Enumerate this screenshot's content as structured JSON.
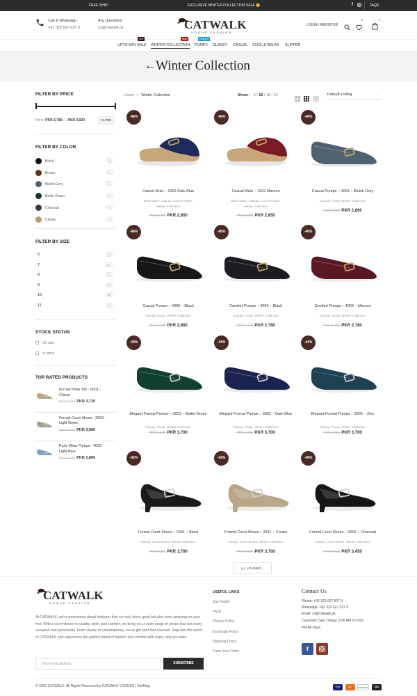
{
  "topbar": {
    "left": "FREE SHIP!",
    "center": "EXCLUSIVE WINTER COLLECTION SALE 🙂",
    "right": "FAQS"
  },
  "header": {
    "call_title": "Call & Whatsapp",
    "call_number": "+92 322 627 627 9",
    "q_title": "Any questions",
    "q_email": "cs@catwalk.pk",
    "logo": "CATWALK",
    "logo_sub": "VOGUE  FASHION",
    "login": "LOGIN / REGISTER",
    "wishlist_count": "0",
    "cart_count": "0"
  },
  "nav": {
    "items": [
      "UPTO 50% SALE",
      "WINTER COLLECTION",
      "PUMPS",
      "GLASSY",
      "CASUAL",
      "COOL & RELAX",
      "SLIPPER"
    ],
    "tags": [
      "HOT",
      "NEW",
      "FASHION"
    ]
  },
  "banner": {
    "title": "Winter Collection",
    "back": "←"
  },
  "breadcrumb": {
    "home": "Home",
    "sep": "/",
    "current": "Winter Collection"
  },
  "toolbar": {
    "show_label": "Show :",
    "show_opts": [
      "9",
      "12",
      "18",
      "24"
    ],
    "sort": "Default sorting"
  },
  "filters": {
    "price": {
      "title": "FILTER BY PRICE",
      "label": "Price:",
      "min": "PKR 2,780",
      "dash": "—",
      "max": "PKR 3,920",
      "button": "FILTER"
    },
    "color": {
      "title": "FILTER BY COLOR",
      "items": [
        {
          "name": "Black",
          "count": "6",
          "hex": "#111111"
        },
        {
          "name": "Brown",
          "count": "1",
          "hex": "#5a3318"
        },
        {
          "name": "Bluish Grey",
          "count": "1",
          "hex": "#4f6270"
        },
        {
          "name": "Bottle Green",
          "count": "1",
          "hex": "#14382c"
        },
        {
          "name": "Charcoal",
          "count": "1",
          "hex": "#3a3a3a"
        },
        {
          "name": "Chicko",
          "count": "3",
          "hex": "#b99a75"
        }
      ]
    },
    "size": {
      "title": "FILTER BY SIZE",
      "items": [
        {
          "name": "6",
          "count": "13"
        },
        {
          "name": "7",
          "count": "27"
        },
        {
          "name": "8",
          "count": "27"
        },
        {
          "name": "9",
          "count": "27"
        },
        {
          "name": "10",
          "count": "28"
        },
        {
          "name": "11",
          "count": "9"
        }
      ]
    },
    "stock": {
      "title": "STOCK STATUS",
      "items": [
        "On sale",
        "In stock"
      ]
    }
  },
  "top_rated": {
    "title": "TOP RATED PRODUCTS",
    "items": [
      {
        "name1": "Formal Peep Toe - 6001 -",
        "name2": "Chicko",
        "old": "PKR 7,440",
        "price": "PKR 3,720"
      },
      {
        "name1": "Formal Court Shoes - 2003 -",
        "name2": "Light Green",
        "old": "PKR 6,550",
        "price": "PKR 3,580"
      },
      {
        "name1": "Party Wear Pumps - 4003 -",
        "name2": "Light Blue",
        "old": "PKR 5,320",
        "price": "PKR 2,860"
      }
    ]
  },
  "products": [
    {
      "badge": "-46%",
      "name": "Casual Mule – 1002 Dark Blue",
      "cat1": "Back Open, Casual, Cool & Relax,",
      "cat2": "Winter Collection",
      "old": "PKR 5,280",
      "price": "PKR 2,850"
    },
    {
      "badge": "-46%",
      "name": "Casual Mule – 1002 Maroon",
      "cat1": "Back Open, Casual, Cool & Relax,",
      "cat2": "Winter Collection",
      "old": "PKR 5,280",
      "price": "PKR 2,850"
    },
    {
      "badge": "-46%",
      "name": "Casual Pumps – 4004 – Bluish Grey",
      "cat1": "Casual, Pump, Winter Collection",
      "cat2": "",
      "old": "PKR 5,300",
      "price": "PKR 2,860"
    },
    {
      "badge": "-46%",
      "name": "Casual Pumps – 4005 – Black",
      "cat1": "Casual, Pump, Winter Collection",
      "cat2": "",
      "old": "PKR 5,300",
      "price": "PKR 2,860"
    },
    {
      "badge": "-46%",
      "name": "Comfort Pumps – 4002 – Black",
      "cat1": "Casual, Pump, Winter Collection",
      "cat2": "",
      "old": "PKR 5,150",
      "price": "PKR 2,780"
    },
    {
      "badge": "-46%",
      "name": "Comfort Pumps – 4002 – Maroon",
      "cat1": "Casual, Pump, Winter Collection",
      "cat2": "",
      "old": "PKR 5,150",
      "price": "PKR 2,780"
    },
    {
      "badge": "-44%",
      "name": "Elegant Formal Pumps – 3001 – Bottle Green",
      "cat1": "Glassy, Pump, Winter Collection",
      "cat2": "",
      "old": "PKR 6,600",
      "price": "PKR 3,700"
    },
    {
      "badge": "-44%",
      "name": "Elegant Formal Pumps – 3002 – Dark Blue",
      "cat1": "Glassy, Pump, Winter Collection",
      "cat2": "",
      "old": "PKR 6,600",
      "price": "PKR 3,700"
    },
    {
      "badge": "-44%",
      "name": "Elegant Formal Pumps – 3002 – Zinc",
      "cat1": "Glassy, Pump, Winter Collection",
      "cat2": "",
      "old": "PKR 6,600",
      "price": "PKR 3,700"
    },
    {
      "badge": "-42%",
      "name": "Formal Court Shoes – 2001 – Black",
      "cat1": "Glassy, Court Shoes, Winter Collection",
      "cat2": "",
      "old": "PKR 6,390",
      "price": "PKR 3,700"
    },
    {
      "badge": "-42%",
      "name": "Formal Court Shoes – 2001 – Cream",
      "cat1": "Glassy, Court Shoes, Winter Collection",
      "cat2": "",
      "old": "PKR 6,390",
      "price": "PKR 3,700"
    },
    {
      "badge": "-46%",
      "name": "Formal Court Shoes – 2002 – Charcoal",
      "cat1": "Glassy, Court Shoes, Winter Collection",
      "cat2": "",
      "old": "PKR 6,390",
      "price": "PKR 3,450"
    }
  ],
  "loading": "LOADING...",
  "footer": {
    "about": "At CATWALK, we're passionate about footwear that not only looks great but also feels amazing on your feet. With a commitment to quality, style, and comfort, we bring you a wide range of shoes that suit every occasion and personality. From classic to contemporary, we've got your feet covered. Step into the world of CATWALK and experience the perfect blend of fashion and comfort with every step you take.",
    "email_placeholder": "Your email address",
    "subscribe": "SUBSCRIBE",
    "useful_title": "USEFUL LINKS",
    "links": [
      "Size Guide",
      "FAQs",
      "Privacy Policy",
      "Exchange Policy",
      "Shipping Policy",
      "Track Your Order"
    ],
    "contact_title": "Contact Us",
    "phone": "Phone: +92 322 627 627 9",
    "whatsapp": "Whatsapp: +92 322 627 627 9",
    "email": "Email: cs@catwalk.pk",
    "timing1": "Customer Care Timing: 9:00 AM To 9:00",
    "timing2": "PM All Days",
    "copyright": "© 2023 CATWALK. All Rights Reserved by CATWALK VOGUES | SiteMap",
    "payments": [
      "VISA",
      "MC",
      "easypaisa",
      "COD"
    ]
  },
  "colors": {
    "badge": "#4a2a23",
    "accent": "#2b2b2b",
    "hot": "#8b1a1a",
    "new": "#c41e1e",
    "fashion": "#1aa3c8"
  }
}
